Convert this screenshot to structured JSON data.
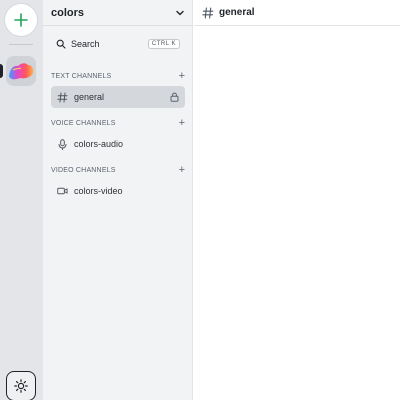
{
  "rail": {
    "add_icon": "plus-icon",
    "add_color": "#23a55a",
    "server_icon": "colorful-blob-icon",
    "settings_icon": "sun-gear-icon"
  },
  "sidebar": {
    "server_name": "colors",
    "search": {
      "label": "Search",
      "shortcut": "CTRL K"
    },
    "categories": [
      {
        "title": "TEXT CHANNELS",
        "channels": [
          {
            "name": "general",
            "icon": "hash-icon",
            "locked": true,
            "active": true
          }
        ]
      },
      {
        "title": "VOICE CHANNELS",
        "channels": [
          {
            "name": "colors-audio",
            "icon": "microphone-icon"
          }
        ]
      },
      {
        "title": "VIDEO CHANNELS",
        "channels": [
          {
            "name": "colors-video",
            "icon": "video-camera-icon"
          }
        ]
      }
    ]
  },
  "main": {
    "channel_title": "general",
    "icon": "hash-icon"
  }
}
